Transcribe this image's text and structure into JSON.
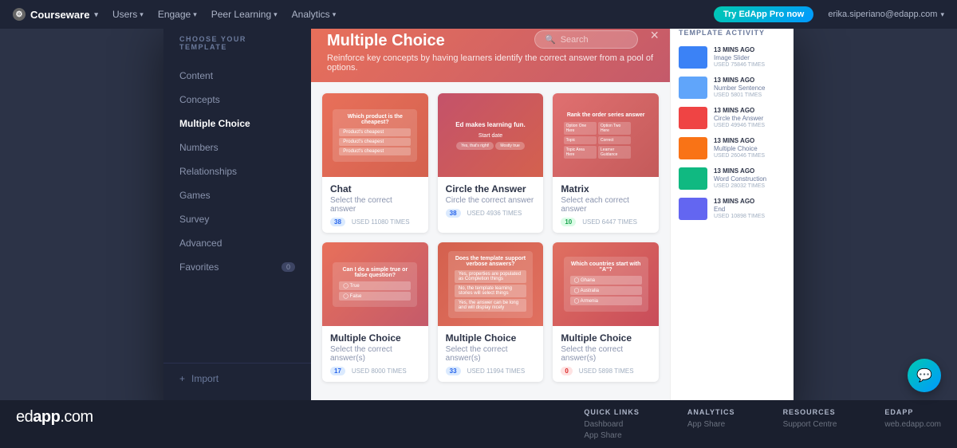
{
  "nav": {
    "logo_label": "Courseware",
    "items": [
      {
        "label": "Users",
        "has_arrow": true
      },
      {
        "label": "Engage",
        "has_arrow": true
      },
      {
        "label": "Peer Learning",
        "has_arrow": true
      },
      {
        "label": "Analytics",
        "has_arrow": true
      }
    ],
    "try_pro": "Try EdApp Pro now",
    "user_email": "erika.siperiano@edapp.com"
  },
  "modal": {
    "close_label": "×",
    "header": {
      "title": "Multiple Choice",
      "subtitle": "Reinforce key concepts by having learners identify the correct answer from a pool of options.",
      "search_placeholder": "Search"
    },
    "sidebar": {
      "section_title": "CHOOSE YOUR TEMPLATE",
      "items": [
        {
          "label": "Content",
          "active": false
        },
        {
          "label": "Concepts",
          "active": false
        },
        {
          "label": "Multiple Choice",
          "active": true
        },
        {
          "label": "Numbers",
          "active": false
        },
        {
          "label": "Relationships",
          "active": false
        },
        {
          "label": "Games",
          "active": false
        },
        {
          "label": "Survey",
          "active": false
        },
        {
          "label": "Advanced",
          "active": false
        },
        {
          "label": "Favorites",
          "active": false,
          "badge": "0"
        }
      ],
      "import_label": "+ Import"
    },
    "templates": [
      {
        "title": "Chat",
        "desc": "Select the correct answer",
        "badge_text": "38",
        "badge_type": "blue",
        "usage": "USED 11080 TIMES",
        "preview_type": "chat"
      },
      {
        "title": "Circle the Answer",
        "desc": "Circle the correct answer",
        "badge_text": "38",
        "badge_type": "blue",
        "usage": "USED 4936 TIMES",
        "preview_type": "circle"
      },
      {
        "title": "Matrix",
        "desc": "Select each correct answer",
        "badge_text": "10",
        "badge_type": "green",
        "usage": "USED 6447 TIMES",
        "preview_type": "matrix"
      },
      {
        "title": "Multiple Choice",
        "desc": "Select the correct answer(s)",
        "badge_text": "17",
        "badge_type": "blue",
        "usage": "USED 8000 TIMES",
        "preview_type": "tf"
      },
      {
        "title": "Multiple Choice",
        "desc": "Select the correct answer(s)",
        "badge_text": "33",
        "badge_type": "blue",
        "usage": "USED 11994 TIMES",
        "preview_type": "long"
      },
      {
        "title": "Multiple Choice",
        "desc": "Select the correct answer(s)",
        "badge_text": "0",
        "badge_type": "red",
        "usage": "USED 5898 TIMES",
        "preview_type": "geo"
      }
    ],
    "activity": {
      "title": "TEMPLATE ACTIVITY",
      "items": [
        {
          "time": "13 MINS AGO",
          "name": "Image Slider",
          "usage": "USED 75846 TIMES",
          "color": "#3b82f6"
        },
        {
          "time": "13 MINS AGO",
          "name": "Number Sentence",
          "usage": "USED 5801 TIMES",
          "color": "#60a5fa"
        },
        {
          "time": "13 MINS AGO",
          "name": "Circle the Answer",
          "usage": "USED 49946 TIMES",
          "color": "#ef4444"
        },
        {
          "time": "13 MINS AGO",
          "name": "Multiple Choice",
          "usage": "USED 26046 TIMES",
          "color": "#f97316"
        },
        {
          "time": "13 MINS AGO",
          "name": "Word Construction",
          "usage": "USED 28032 TIMES",
          "color": "#10b981"
        },
        {
          "time": "13 MINS AGO",
          "name": "End",
          "usage": "USED 10898 TIMES",
          "color": "#6366f1"
        }
      ]
    }
  },
  "footer": {
    "brand": "edapp.com",
    "columns": [
      {
        "title": "QUICK LINKS",
        "links": [
          "Dashboard",
          "App Share"
        ]
      },
      {
        "title": "ANALYTICS",
        "links": [
          "App Share"
        ]
      },
      {
        "title": "RESOURCES",
        "links": [
          "Support Centre"
        ]
      },
      {
        "title": "EDAPP",
        "links": [
          "web.edapp.com"
        ]
      }
    ]
  }
}
